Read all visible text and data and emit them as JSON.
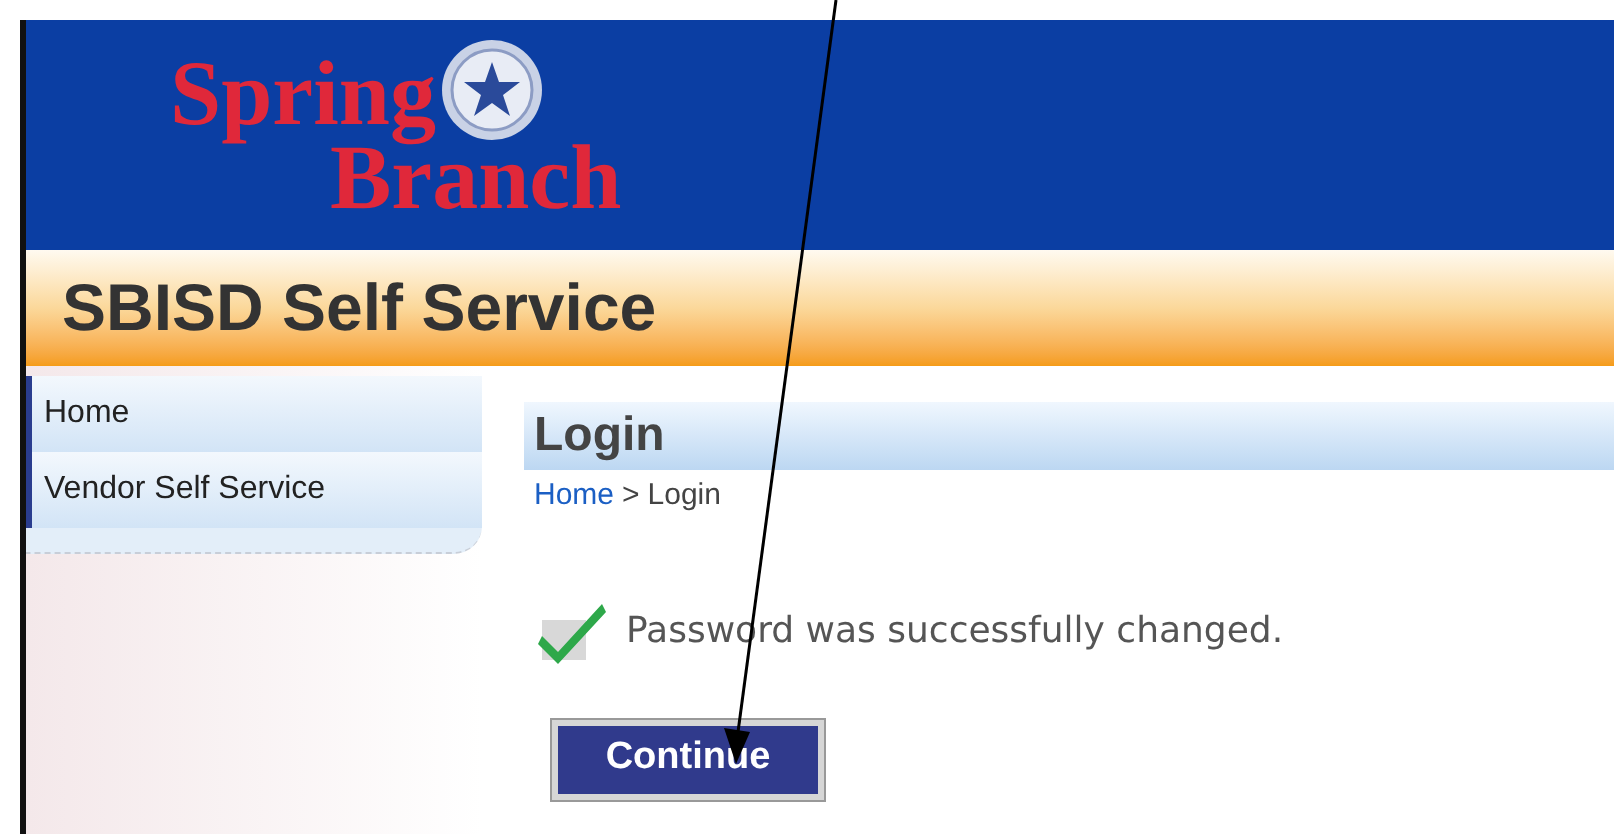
{
  "header": {
    "logo": {
      "line_1": "Spring",
      "line_2": "Branch"
    }
  },
  "banner": {
    "title": "SBISD Self Service"
  },
  "sidebar": {
    "items": [
      {
        "label": "Home"
      },
      {
        "label": "Vendor Self Service"
      }
    ]
  },
  "page": {
    "title": "Login",
    "breadcrumb": {
      "link": "Home",
      "separator": ">",
      "current": "Login"
    },
    "message": {
      "text": "Password was successfully changed."
    },
    "button": "Continue"
  }
}
